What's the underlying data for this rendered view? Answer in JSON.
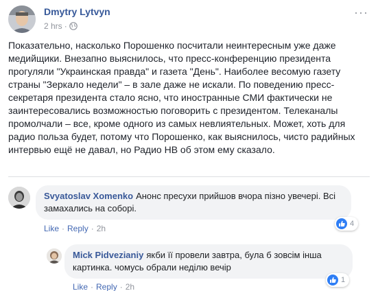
{
  "post": {
    "author": "Dmytry Lytvyn",
    "time": "2 hrs",
    "meta_dot": "·",
    "privacy_icon": "globe-icon",
    "options_icon": "more-options-icon",
    "options_label": "···",
    "text": "Показательно, насколько Порошенко посчитали неинтересным уже даже медийщики. Внезапно выяснилось, что пресс-конференцию президента прогуляли \"Украинская правда\" и газета \"День\". Наиболее весомую газету страны \"Зеркало недели\" – в зале даже не искали. По поведению пресс-секретаря президента стало ясно, что иностранные СМИ фактически не заинтересовались возможностью поговорить с президентом. Телеканалы промолчали – все, кроме одного из самых невлиятельных. Может, хоть для радио польза будет, потому что Порошенко, как выяснилось, чисто радийных интервью ещё не давал, но Радио НВ об этом ему сказало."
  },
  "comments": [
    {
      "author": "Svyatoslav Xomenko",
      "text": "Анонс пресухи прийшов вчора пізно увечері. Всі замахались на соборі.",
      "like_label": "Like",
      "reply_label": "Reply",
      "separator": "·",
      "time": "2h",
      "reaction_icon": "like-icon",
      "reaction_count": "4"
    },
    {
      "author": "Mick Pidvezianiy",
      "text": "якби її провели завтра, була б зовсім інша картинка. чомусь обрали неділю вечір",
      "like_label": "Like",
      "reply_label": "Reply",
      "separator": "·",
      "time": "2h",
      "reaction_icon": "like-icon",
      "reaction_count": "1"
    }
  ],
  "colors": {
    "link": "#365899",
    "meta": "#90949c",
    "bubble": "#f2f3f5",
    "like_blue": "#2f7ef5"
  }
}
